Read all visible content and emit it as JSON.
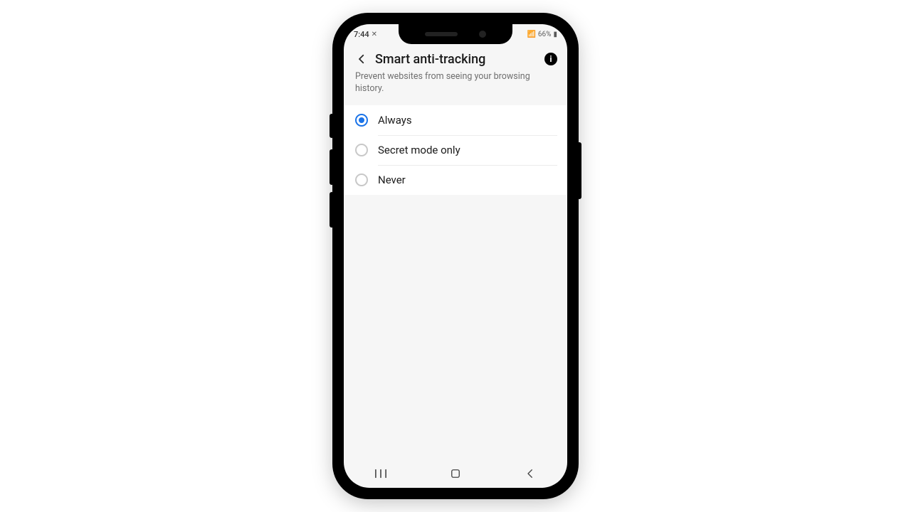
{
  "statusbar": {
    "time": "7:44",
    "battery": "66%"
  },
  "header": {
    "title": "Smart anti-tracking",
    "description": "Prevent websites from seeing your browsing history."
  },
  "options": [
    {
      "label": "Always",
      "selected": true
    },
    {
      "label": "Secret mode only",
      "selected": false
    },
    {
      "label": "Never",
      "selected": false
    }
  ]
}
